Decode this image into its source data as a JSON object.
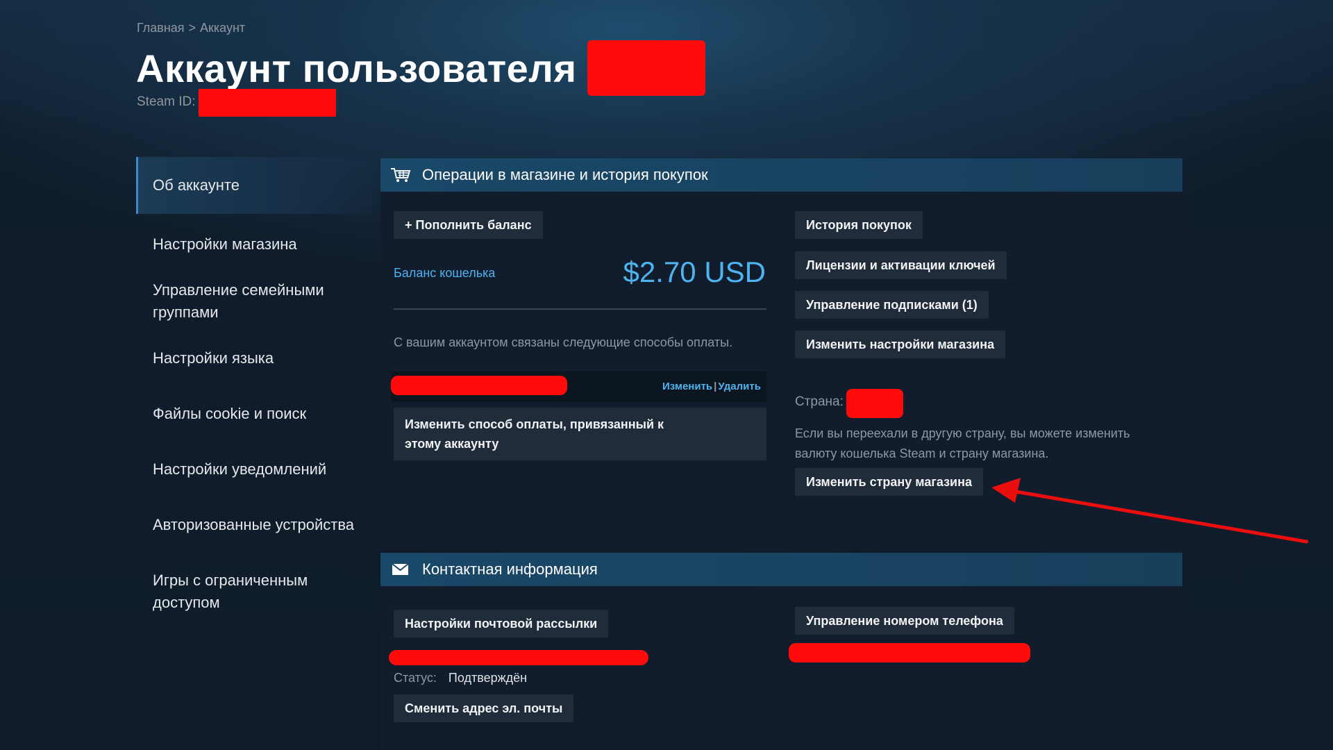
{
  "breadcrumb": {
    "home": "Главная",
    "separator": ">",
    "current": "Аккаунт"
  },
  "header": {
    "title": "Аккаунт пользователя",
    "steam_id_label": "Steam ID:"
  },
  "sidebar": {
    "items": [
      {
        "label": "Об аккаунте",
        "active": true
      },
      {
        "label": "Настройки магазина"
      },
      {
        "label": "Управление семейными группами"
      },
      {
        "label": "Настройки языка"
      },
      {
        "label": "Файлы cookie и поиск"
      },
      {
        "label": "Настройки уведомлений"
      },
      {
        "label": "Авторизованные устройства"
      },
      {
        "label": "Игры с ограниченным доступом"
      }
    ]
  },
  "store_panel": {
    "title": "Операции в магазине и история покупок",
    "icon": "cart-icon",
    "add_funds": "+ Пополнить баланс",
    "wallet_label": "Баланс кошелька",
    "wallet_amount": "$2.70 USD",
    "payment_text": "С вашим аккаунтом связаны следующие способы оплаты.",
    "edit_link": "Изменить",
    "link_separator": "|",
    "delete_link": "Удалить",
    "change_payment": "Изменить способ оплаты, привязанный к этому аккаунту",
    "purchase_history": "История покупок",
    "licenses": "Лицензии и активации ключей",
    "subscriptions": "Управление подписками (1)",
    "store_settings": "Изменить настройки магазина",
    "country_label": "Страна:",
    "country_text": "Если вы переехали в другую страну, вы можете изменить валюту кошелька Steam и страну магазина.",
    "change_country": "Изменить страну магазина"
  },
  "contact_panel": {
    "title": "Контактная информация",
    "icon": "envelope-icon",
    "newsletter": "Настройки почтовой рассылки",
    "status_label": "Статус:",
    "status_value": "Подтверждён",
    "change_email": "Сменить адрес эл. почты",
    "manage_phone": "Управление номером телефона"
  },
  "colors": {
    "accent": "#4fb3ef",
    "redaction": "#ff0b0b",
    "arrow": "#ea0e0e"
  }
}
